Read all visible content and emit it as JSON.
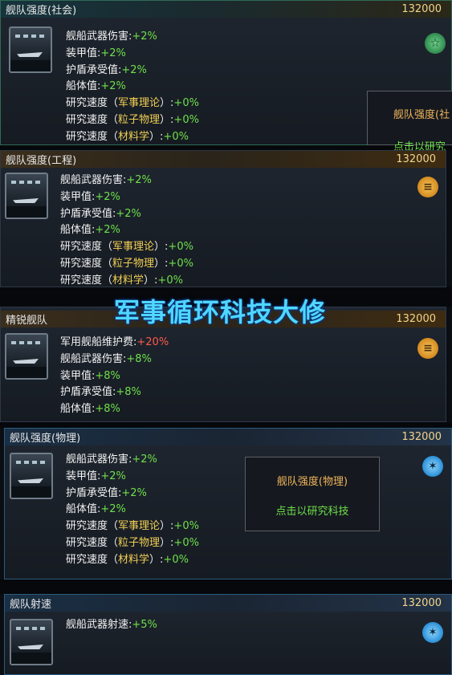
{
  "cards": [
    {
      "title": "舰队强度(社会)",
      "cost": "132000",
      "icon": "social-research-icon",
      "stats": [
        {
          "label": "舰船武器伤害:",
          "value": "+2%"
        },
        {
          "label": "装甲值:",
          "value": "+2%"
        },
        {
          "label": "护盾承受值:",
          "value": "+2%"
        },
        {
          "label": "船体值:",
          "value": "+2%"
        },
        {
          "label": "研究速度（",
          "cat": "军事理论",
          "tail": "）:",
          "value": "+0%"
        },
        {
          "label": "研究速度（",
          "cat": "粒子物理",
          "tail": "）:",
          "value": "+0%"
        },
        {
          "label": "研究速度（",
          "cat": "材料学",
          "tail": "）:",
          "value": "+0%"
        }
      ]
    },
    {
      "title": "舰队强度(工程)",
      "cost": "132000",
      "icon": "engineering-research-icon",
      "stats": [
        {
          "label": "舰船武器伤害:",
          "value": "+2%"
        },
        {
          "label": "装甲值:",
          "value": "+2%"
        },
        {
          "label": "护盾承受值:",
          "value": "+2%"
        },
        {
          "label": "船体值:",
          "value": "+2%"
        },
        {
          "label": "研究速度（",
          "cat": "军事理论",
          "tail": "）:",
          "value": "+0%"
        },
        {
          "label": "研究速度（",
          "cat": "粒子物理",
          "tail": "）:",
          "value": "+0%"
        },
        {
          "label": "研究速度（",
          "cat": "材料学",
          "tail": "）:",
          "value": "+0%"
        }
      ]
    },
    {
      "title": "精锐舰队",
      "cost": "132000",
      "icon": "engineering-research-icon",
      "stats": [
        {
          "label": "军用舰船维护费:",
          "value": "+20%"
        },
        {
          "label": "舰船武器伤害:",
          "value": "+8%"
        },
        {
          "label": "装甲值:",
          "value": "+8%"
        },
        {
          "label": "护盾承受值:",
          "value": "+8%"
        },
        {
          "label": "船体值:",
          "value": "+8%"
        }
      ]
    },
    {
      "title": "舰队强度(物理)",
      "cost": "132000",
      "icon": "physics-research-icon",
      "stats": [
        {
          "label": "舰船武器伤害:",
          "value": "+2%"
        },
        {
          "label": "装甲值:",
          "value": "+2%"
        },
        {
          "label": "护盾承受值:",
          "value": "+2%"
        },
        {
          "label": "船体值:",
          "value": "+2%"
        },
        {
          "label": "研究速度（",
          "cat": "军事理论",
          "tail": "）:",
          "value": "+0%"
        },
        {
          "label": "研究速度（",
          "cat": "粒子物理",
          "tail": "）:",
          "value": "+0%"
        },
        {
          "label": "研究速度（",
          "cat": "材料学",
          "tail": "）:",
          "value": "+0%"
        }
      ]
    },
    {
      "title": "舰队射速",
      "cost": "132000",
      "icon": "physics-research-icon",
      "stats": [
        {
          "label": "舰船武器射速:",
          "value": "+5%"
        }
      ]
    }
  ],
  "tooltip_partial": {
    "line1": "舰队强度(社",
    "line2": "点击以研究"
  },
  "tooltip_full": {
    "line1": "舰队强度(物理)",
    "line2": "点击以研究科技"
  },
  "banner": "军事循环科技大修",
  "colors": {
    "positive": "#6fe04a",
    "negative": "#ff5a4e",
    "category": "#f1cf53",
    "cost": "#f3d58a",
    "banner": "#4fd7ff"
  }
}
